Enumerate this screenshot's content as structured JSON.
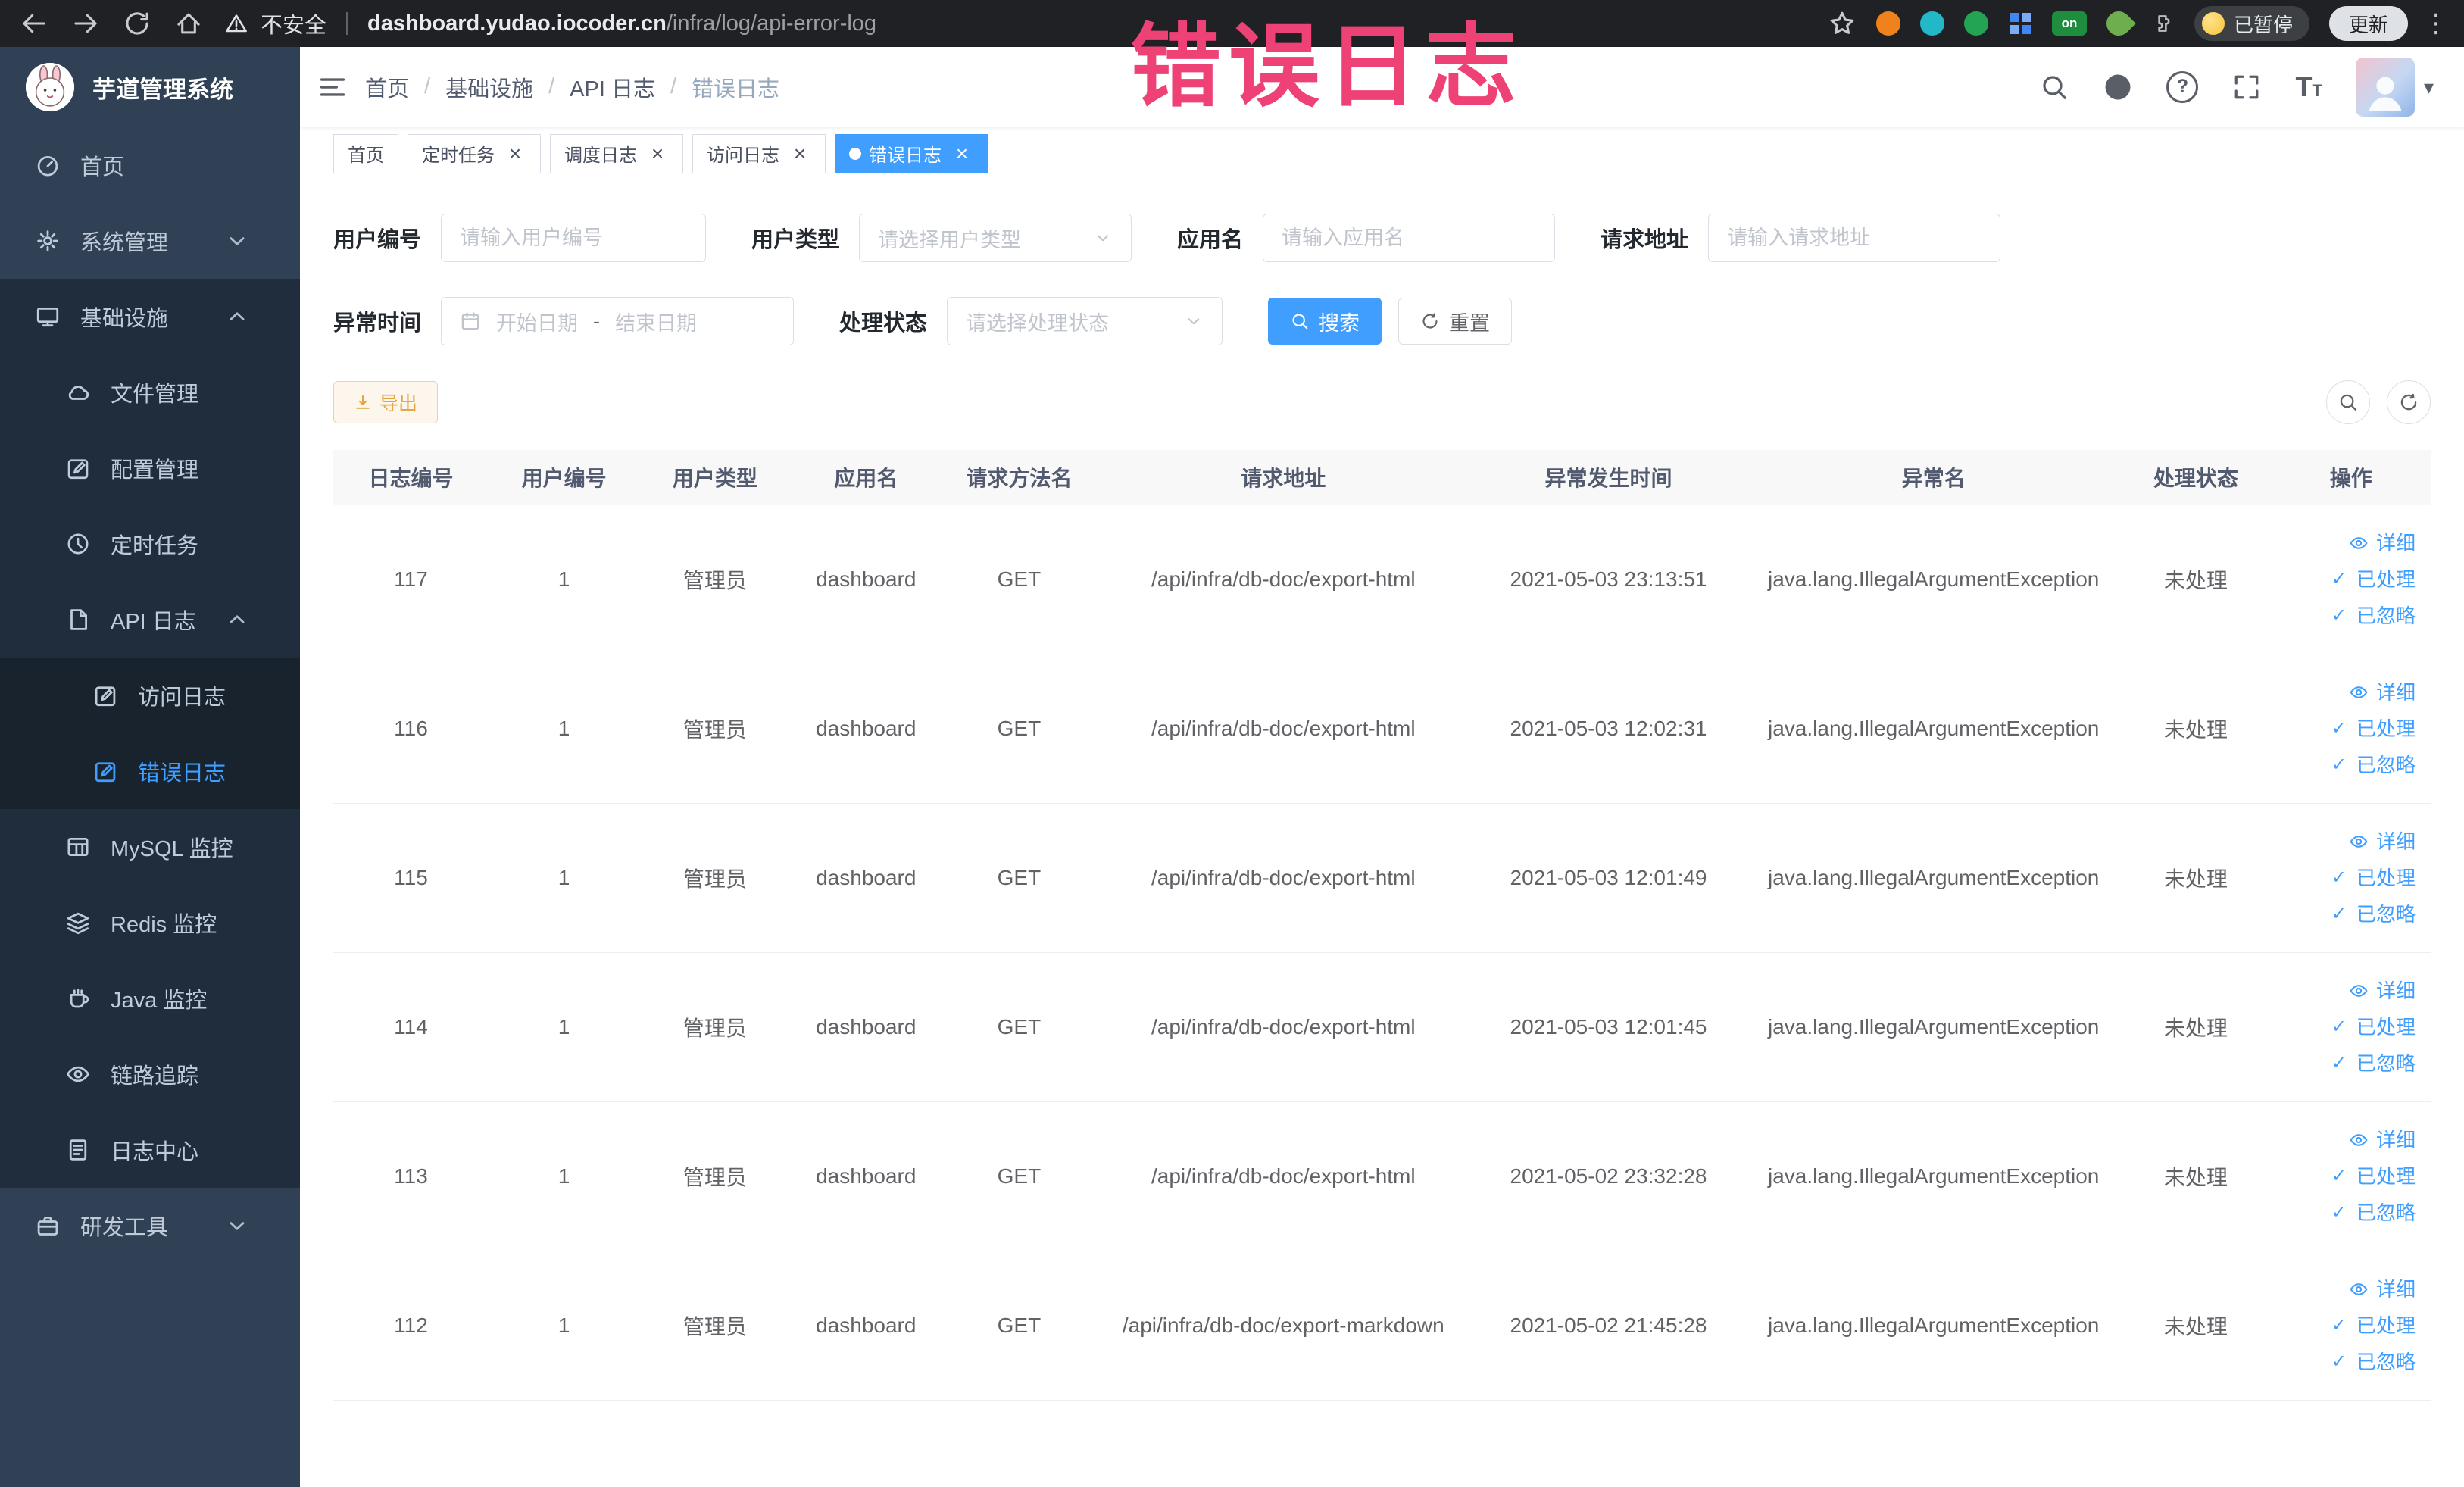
{
  "theme": {
    "accent": "#409eff",
    "annotation": "#ee4277",
    "warning": "#e6a23c",
    "sidebar_bg": "#304156",
    "sidebar_sub_bg": "#1f2d3d",
    "sidebar_text": "#bfcbd9"
  },
  "annotation": {
    "text": "错误日志"
  },
  "icons": {
    "close": "×",
    "caret": "▾",
    "check": "✓",
    "kebab": "⋮",
    "question": "?",
    "text_big": "T",
    "text_small": "T"
  },
  "browser": {
    "security_label": "不安全",
    "url_host": "dashboard.yudao.iocoder.cn",
    "url_path": "/infra/log/api-error-log",
    "on_badge": "on",
    "paused_badge": "已暂停",
    "update_button": "更新"
  },
  "sidebar": {
    "logo_title": "芋道管理系统",
    "items": [
      {
        "key": "home",
        "label": "首页",
        "icon": "gauge",
        "depth": 0,
        "bg": 0
      },
      {
        "key": "system",
        "label": "系统管理",
        "icon": "gear",
        "depth": 0,
        "bg": 0,
        "arrow": "down"
      },
      {
        "key": "infra",
        "label": "基础设施",
        "icon": "monitor",
        "depth": 0,
        "bg": 1,
        "arrow": "up"
      },
      {
        "key": "file",
        "label": "文件管理",
        "icon": "cloud",
        "depth": 1,
        "bg": 1
      },
      {
        "key": "config",
        "label": "配置管理",
        "icon": "edit",
        "depth": 1,
        "bg": 1
      },
      {
        "key": "job",
        "label": "定时任务",
        "icon": "clock",
        "depth": 1,
        "bg": 1
      },
      {
        "key": "api-log",
        "label": "API 日志",
        "icon": "doc",
        "depth": 1,
        "bg": 1,
        "arrow": "up"
      },
      {
        "key": "access-log",
        "label": "访问日志",
        "icon": "edit",
        "depth": 2,
        "bg": 2
      },
      {
        "key": "error-log",
        "label": "错误日志",
        "icon": "edit",
        "depth": 2,
        "bg": 2,
        "active": true
      },
      {
        "key": "mysql",
        "label": "MySQL 监控",
        "icon": "grid",
        "depth": 1,
        "bg": 1
      },
      {
        "key": "redis",
        "label": "Redis 监控",
        "icon": "layers",
        "depth": 1,
        "bg": 1
      },
      {
        "key": "java",
        "label": "Java 监控",
        "icon": "cup",
        "depth": 1,
        "bg": 1
      },
      {
        "key": "tracer",
        "label": "链路追踪",
        "icon": "eye",
        "depth": 1,
        "bg": 1
      },
      {
        "key": "log-center",
        "label": "日志中心",
        "icon": "filetext",
        "depth": 1,
        "bg": 1
      },
      {
        "key": "dev-tools",
        "label": "研发工具",
        "icon": "tool",
        "depth": 0,
        "bg": 0,
        "arrow": "down"
      }
    ]
  },
  "header": {
    "breadcrumb": [
      "首页",
      "基础设施",
      "API 日志",
      "错误日志"
    ]
  },
  "tabs": [
    {
      "key": "home",
      "label": "首页",
      "closable": false,
      "active": false
    },
    {
      "key": "job",
      "label": "定时任务",
      "closable": true,
      "active": false
    },
    {
      "key": "job-log",
      "label": "调度日志",
      "closable": true,
      "active": false
    },
    {
      "key": "access-log",
      "label": "访问日志",
      "closable": true,
      "active": false
    },
    {
      "key": "error-log",
      "label": "错误日志",
      "closable": true,
      "active": true
    }
  ],
  "filters": {
    "user_id": {
      "label": "用户编号",
      "placeholder": "请输入用户编号"
    },
    "user_type": {
      "label": "用户类型",
      "placeholder": "请选择用户类型"
    },
    "app_name": {
      "label": "应用名",
      "placeholder": "请输入应用名"
    },
    "request_url": {
      "label": "请求地址",
      "placeholder": "请输入请求地址"
    },
    "exception_time": {
      "label": "异常时间",
      "start_placeholder": "开始日期",
      "separator": "-",
      "end_placeholder": "结束日期"
    },
    "process_status": {
      "label": "处理状态",
      "placeholder": "请选择处理状态"
    },
    "search_button": "搜索",
    "reset_button": "重置"
  },
  "toolbar": {
    "export_button": "导出"
  },
  "table": {
    "columns": [
      "日志编号",
      "用户编号",
      "用户类型",
      "应用名",
      "请求方法名",
      "请求地址",
      "异常发生时间",
      "异常名",
      "处理状态",
      "操作"
    ],
    "actions": [
      {
        "key": "detail",
        "label": "详细",
        "icon": "eye"
      },
      {
        "key": "processed",
        "label": "已处理",
        "icon": "check"
      },
      {
        "key": "ignored",
        "label": "已忽略",
        "icon": "check"
      }
    ],
    "rows": [
      {
        "id": "117",
        "user_id": "1",
        "user_type": "管理员",
        "app": "dashboard",
        "method": "GET",
        "url": "/api/infra/db-doc/export-html",
        "time": "2021-05-03 23:13:51",
        "exception": "java.lang.IllegalArgumentException",
        "status": "未处理"
      },
      {
        "id": "116",
        "user_id": "1",
        "user_type": "管理员",
        "app": "dashboard",
        "method": "GET",
        "url": "/api/infra/db-doc/export-html",
        "time": "2021-05-03 12:02:31",
        "exception": "java.lang.IllegalArgumentException",
        "status": "未处理"
      },
      {
        "id": "115",
        "user_id": "1",
        "user_type": "管理员",
        "app": "dashboard",
        "method": "GET",
        "url": "/api/infra/db-doc/export-html",
        "time": "2021-05-03 12:01:49",
        "exception": "java.lang.IllegalArgumentException",
        "status": "未处理"
      },
      {
        "id": "114",
        "user_id": "1",
        "user_type": "管理员",
        "app": "dashboard",
        "method": "GET",
        "url": "/api/infra/db-doc/export-html",
        "time": "2021-05-03 12:01:45",
        "exception": "java.lang.IllegalArgumentException",
        "status": "未处理"
      },
      {
        "id": "113",
        "user_id": "1",
        "user_type": "管理员",
        "app": "dashboard",
        "method": "GET",
        "url": "/api/infra/db-doc/export-html",
        "time": "2021-05-02 23:32:28",
        "exception": "java.lang.IllegalArgumentException",
        "status": "未处理"
      },
      {
        "id": "112",
        "user_id": "1",
        "user_type": "管理员",
        "app": "dashboard",
        "method": "GET",
        "url": "/api/infra/db-doc/export-markdown",
        "time": "2021-05-02 21:45:28",
        "exception": "java.lang.IllegalArgumentException",
        "status": "未处理"
      }
    ]
  }
}
